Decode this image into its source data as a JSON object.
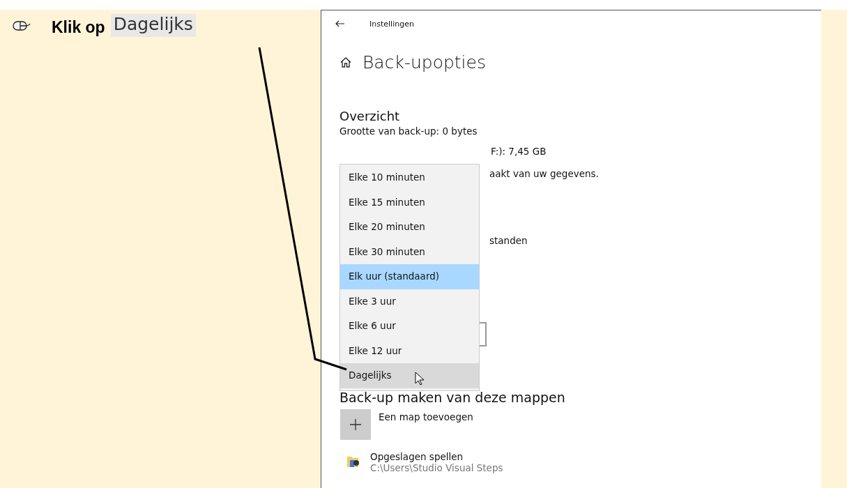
{
  "instruction": {
    "text": "Klik op",
    "target": "Dagelijks"
  },
  "window": {
    "title": "Instellingen"
  },
  "page": {
    "title": "Back-upopties"
  },
  "overview": {
    "heading": "Overzicht",
    "size_line": "Grootte van back-up: 0 bytes",
    "space_fragment": "F:): 7,45 GB",
    "info_fragment": "aakt van uw gegevens.",
    "files_fragment": "standen"
  },
  "dropdown": {
    "options": [
      {
        "label": "Elke 10 minuten",
        "selected": false,
        "hovered": false
      },
      {
        "label": "Elke 15 minuten",
        "selected": false,
        "hovered": false
      },
      {
        "label": "Elke 20 minuten",
        "selected": false,
        "hovered": false
      },
      {
        "label": "Elke 30 minuten",
        "selected": false,
        "hovered": false
      },
      {
        "label": "Elk uur (standaard)",
        "selected": true,
        "hovered": false
      },
      {
        "label": "Elke 3 uur",
        "selected": false,
        "hovered": false
      },
      {
        "label": "Elke 6 uur",
        "selected": false,
        "hovered": false
      },
      {
        "label": "Elke 12 uur",
        "selected": false,
        "hovered": false
      },
      {
        "label": "Dagelijks",
        "selected": false,
        "hovered": true
      }
    ]
  },
  "folders": {
    "heading": "Back-up maken van deze mappen",
    "add_label": "Een map toevoegen",
    "items": [
      {
        "name": "Opgeslagen spellen",
        "path": "C:\\Users\\Studio Visual Steps"
      }
    ]
  }
}
